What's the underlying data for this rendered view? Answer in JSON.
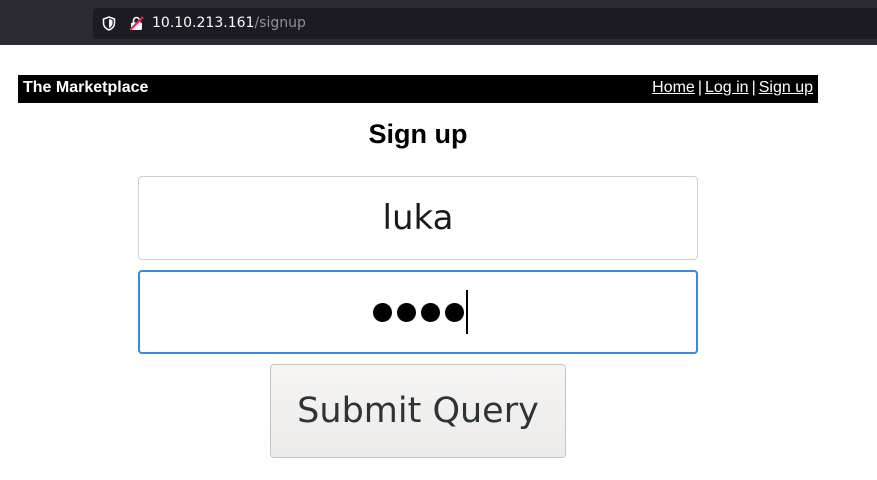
{
  "browser": {
    "url_host": "10.10.213.161",
    "url_path": "/signup"
  },
  "header": {
    "title": "The Marketplace",
    "nav": [
      {
        "label": "Home"
      },
      {
        "label": "Log in"
      },
      {
        "label": "Sign up"
      }
    ],
    "separator": "|"
  },
  "form": {
    "heading": "Sign up",
    "username_value": "luka",
    "password_masked_length": 4,
    "submit_label": "Submit Query"
  },
  "colors": {
    "header_bg": "#000000",
    "focus_border": "#3d86dd",
    "urlbar_bg": "#1c1b22"
  }
}
